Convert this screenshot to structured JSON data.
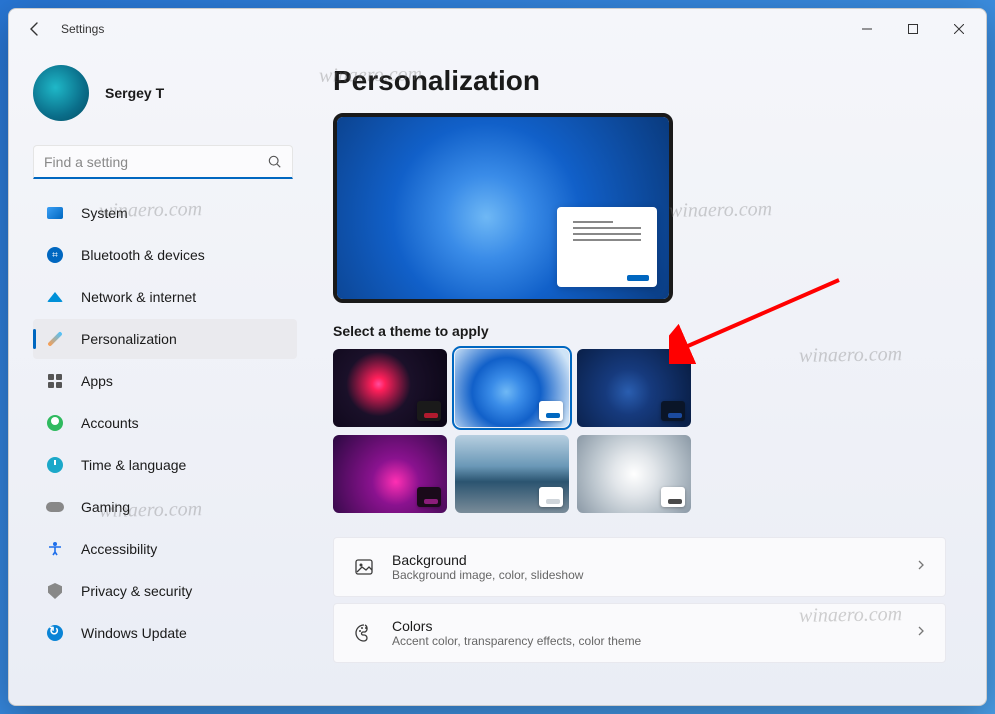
{
  "titlebar": {
    "title": "Settings"
  },
  "user": {
    "name": "Sergey T"
  },
  "search": {
    "placeholder": "Find a setting"
  },
  "nav": {
    "items": [
      {
        "label": "System"
      },
      {
        "label": "Bluetooth & devices"
      },
      {
        "label": "Network & internet"
      },
      {
        "label": "Personalization"
      },
      {
        "label": "Apps"
      },
      {
        "label": "Accounts"
      },
      {
        "label": "Time & language"
      },
      {
        "label": "Gaming"
      },
      {
        "label": "Accessibility"
      },
      {
        "label": "Privacy & security"
      },
      {
        "label": "Windows Update"
      }
    ]
  },
  "page": {
    "title": "Personalization",
    "theme_section_label": "Select a theme to apply",
    "themes": [
      {
        "accent": "#b01a2e"
      },
      {
        "accent": "#0067c0",
        "selected": true
      },
      {
        "accent": "#1b4a9e"
      },
      {
        "accent": "#8b1d7a"
      },
      {
        "accent": "#cfd5da"
      },
      {
        "accent": "#4a4a4a"
      }
    ],
    "rows": [
      {
        "title": "Background",
        "sub": "Background image, color, slideshow"
      },
      {
        "title": "Colors",
        "sub": "Accent color, transparency effects, color theme"
      }
    ]
  },
  "watermark": "winaero.com"
}
